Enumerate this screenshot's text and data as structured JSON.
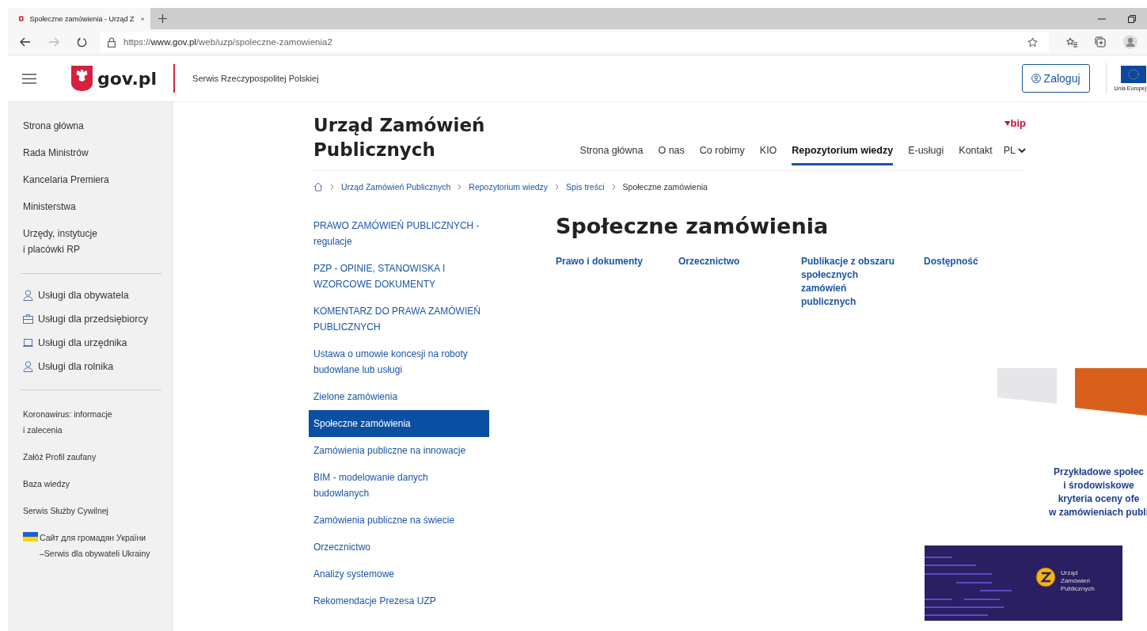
{
  "browser": {
    "tab_title": "Społeczne zamówienia - Urząd Z",
    "url_scheme": "https://",
    "url_host": "www.gov.pl",
    "url_path": "/web/uzp/spoleczne-zamowienia2"
  },
  "header": {
    "logo_text": "gov.pl",
    "tagline": "Serwis Rzeczypospolitej Polskiej",
    "login": "Zaloguj",
    "eu_label": "Unia Europej"
  },
  "sidebar": {
    "main_items": [
      "Strona główna",
      "Rada Ministrów",
      "Kancelaria Premiera",
      "Ministerstwa",
      "Urzędy, instytucje\ni placówki RP"
    ],
    "services": [
      {
        "label": "Usługi dla obywatela",
        "kind": "person"
      },
      {
        "label": "Usługi dla przedsiębiorcy",
        "kind": "briefcase"
      },
      {
        "label": "Usługi dla urzędnika",
        "kind": "monitor"
      },
      {
        "label": "Usługi dla rolnika",
        "kind": "person"
      }
    ],
    "extra_items": [
      "Koronawirus: informacje\ni zalecenia",
      "Załóż Profil zaufany",
      "Baza wiedzy",
      "Serwis Służby Cywilnej"
    ],
    "ukraine_link": "Сайт для громадян України\n–Serwis dla obywateli Ukrainy"
  },
  "site": {
    "name": "Urząd Zamówień\nPublicznych",
    "bip": "bip",
    "lang": "PL",
    "nav": [
      {
        "label": "Strona główna",
        "selected": false
      },
      {
        "label": "O nas",
        "selected": false
      },
      {
        "label": "Co robimy",
        "selected": false
      },
      {
        "label": "KIO",
        "selected": false
      },
      {
        "label": "Repozytorium wiedzy",
        "selected": true
      },
      {
        "label": "E-usługi",
        "selected": false
      },
      {
        "label": "Kontakt",
        "selected": false
      }
    ]
  },
  "breadcrumb": [
    "Urząd Zamówień Publicznych",
    "Repozytorium wiedzy",
    "Spis treści",
    "Społeczne zamówienia"
  ],
  "menu": [
    {
      "label": "PRAWO ZAMÓWIEŃ PUBLICZNYCH -\nregulacje",
      "selected": false
    },
    {
      "label": "PZP - OPINIE, STANOWISKA I\nWZORCOWE DOKUMENTY",
      "selected": false
    },
    {
      "label": "KOMENTARZ DO PRAWA ZAMÓWIEŃ\nPUBLICZNYCH",
      "selected": false
    },
    {
      "label": "Ustawa o umowie koncesji na roboty\nbudowlane lub usługi",
      "selected": false
    },
    {
      "label": "Zielone zamówienia",
      "selected": false
    },
    {
      "label": "Społeczne zamówienia",
      "selected": true
    },
    {
      "label": "Zamówienia publiczne na innowacje",
      "selected": false
    },
    {
      "label": "BIM - modelowanie danych\nbudowlanych",
      "selected": false
    },
    {
      "label": "Zamówienia publiczne na świecie",
      "selected": false
    },
    {
      "label": "Orzecznictwo",
      "selected": false
    },
    {
      "label": "Analizy systemowe",
      "selected": false
    },
    {
      "label": "Rekomendacje Prezesa UZP",
      "selected": false
    }
  ],
  "page": {
    "title": "Społeczne zamówienia",
    "links": [
      "Prawo i dokumenty",
      "Orzecznictwo",
      "Publikacje z obszaru\nspołecznych\nzamówień\npublicznych",
      "Dostępność"
    ]
  },
  "promo": {
    "heading": "Przykładowe społec\ni środowiskowe\nkryteria oceny ofe\nw zamówieniach publi",
    "cover_text": "Urząd\nZamówień\nPublicznych"
  }
}
